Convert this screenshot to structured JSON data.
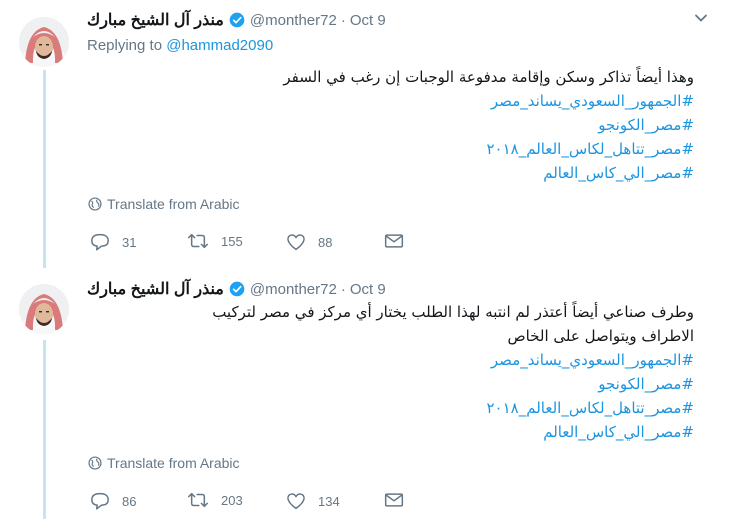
{
  "tweets": [
    {
      "author_name": "منذر آل الشيخ مبارك",
      "handle": "@monther72",
      "separator": "·",
      "date": "Oct 9",
      "reply_prefix": "Replying to ",
      "reply_to": "@hammad2090",
      "body_lines": [
        "وهذا أيضاً تذاكر وسكن وإقامة مدفوعة الوجبات إن رغب في السفر"
      ],
      "hashtags": [
        "#الجمهور_السعودي_يساند_مصر",
        "#مصر_الكونجو",
        "#مصر_تتاهل_لكاس_العالم_٢٠١٨",
        "#مصر_الي_كاس_العالم"
      ],
      "translate_label": "Translate from Arabic",
      "replies": "31",
      "retweets": "155",
      "likes": "88"
    },
    {
      "author_name": "منذر آل الشيخ مبارك",
      "handle": "@monther72",
      "separator": "·",
      "date": "Oct 9",
      "body_lines": [
        "وطرف صناعي أيضاً أعتذر لم انتبه لهذا الطلب يختار أي مركز في مصر لتركيب",
        "الاطراف ويتواصل على الخاص"
      ],
      "hashtags": [
        "#الجمهور_السعودي_يساند_مصر",
        "#مصر_الكونجو",
        "#مصر_تتاهل_لكاس_العالم_٢٠١٨",
        "#مصر_الي_كاس_العالم"
      ],
      "translate_label": "Translate from Arabic",
      "replies": "86",
      "retweets": "203",
      "likes": "134"
    }
  ]
}
